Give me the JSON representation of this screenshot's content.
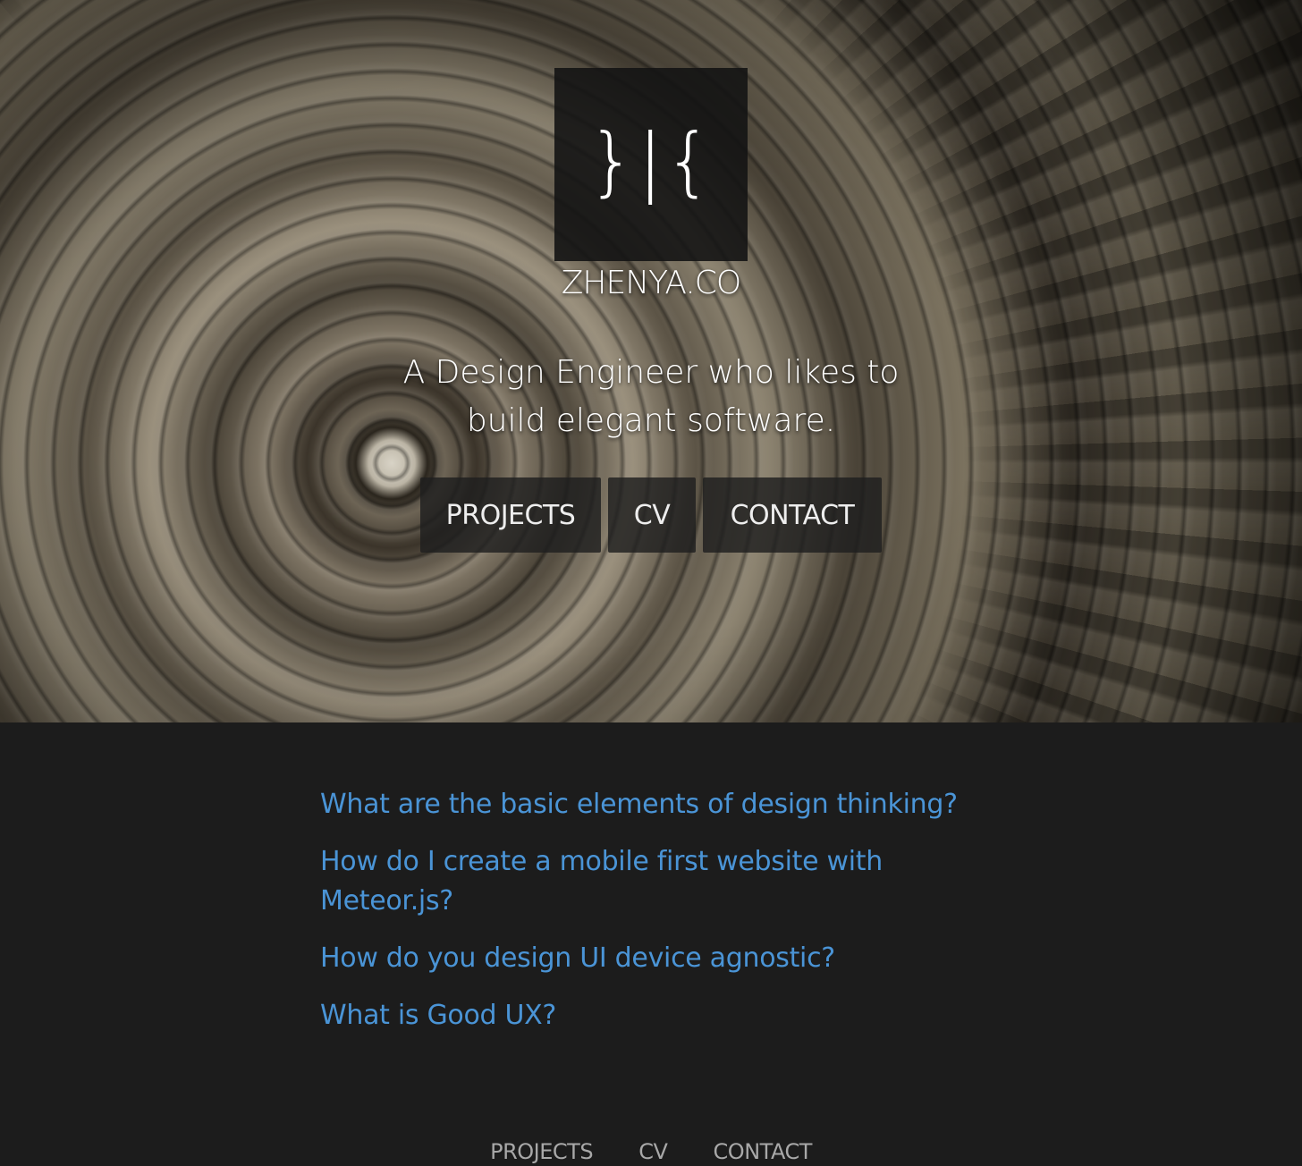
{
  "hero": {
    "logo_glyph": "}|{",
    "site_name": "ZHENYA.CO",
    "tagline": "A Design Engineer who likes to build  elegant  software."
  },
  "nav": {
    "projects": "PROJECTS",
    "cv": "CV",
    "contact": "CONTACT"
  },
  "questions": [
    "What are the basic elements of design thinking?",
    "How do I create a mobile first website with Meteor.js?",
    "How do you design UI device agnostic?",
    "What is Good UX?"
  ],
  "footer": {
    "projects": "PROJECTS",
    "cv": "CV",
    "contact": "CONTACT"
  },
  "colors": {
    "page_background": "#1c1c1c",
    "link": "#4a94d6",
    "footer_text": "#a8a8a8"
  }
}
